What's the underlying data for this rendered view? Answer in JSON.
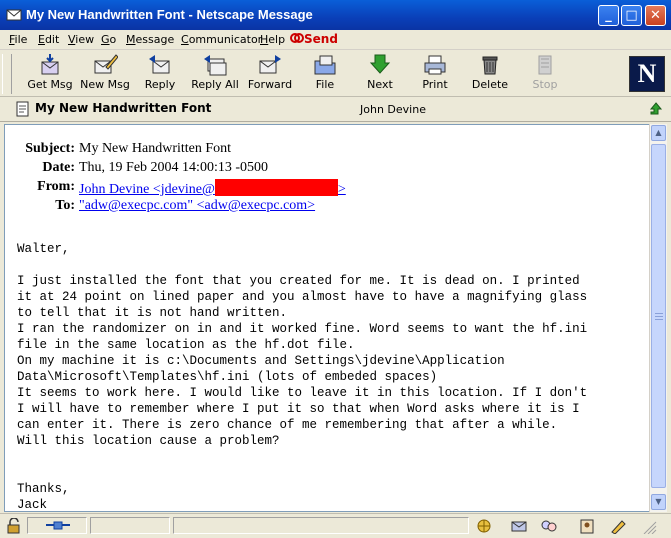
{
  "window": {
    "title": "My New Handwritten Font - Netscape Message"
  },
  "menu": {
    "items": [
      {
        "label": "File",
        "key": "F",
        "rest": "ile"
      },
      {
        "label": "Edit",
        "key": "E",
        "rest": "dit"
      },
      {
        "label": "View",
        "key": "V",
        "rest": "iew"
      },
      {
        "label": "Go",
        "key": "G",
        "rest": "o"
      },
      {
        "label": "Message",
        "key": "M",
        "rest": "essage"
      },
      {
        "label": "Communicator",
        "key": "C",
        "rest": "ommunicator"
      },
      {
        "label": "Help",
        "key": "H",
        "rest": "elp"
      }
    ],
    "send_label": "Send"
  },
  "toolbar": {
    "get_msg": "Get Msg",
    "new_msg": "New Msg",
    "reply": "Reply",
    "reply_all": "Reply All",
    "forward": "Forward",
    "file": "File",
    "next": "Next",
    "print": "Print",
    "delete": "Delete",
    "stop": "Stop",
    "logo_letter": "N"
  },
  "subject_bar": {
    "title": "My New Handwritten Font",
    "author": "John Devine"
  },
  "headers": {
    "subject_label": "Subject:",
    "subject_value": "My New Handwritten Font",
    "date_label": "Date:",
    "date_value": "Thu, 19 Feb 2004 14:00:13 -0500",
    "from_label": "From:",
    "from_value_start": "John Devine <jdevine@",
    "from_value_end": ">",
    "to_label": "To:",
    "to_value": "\"adw@execpc.com\" <adw@execpc.com>"
  },
  "body": {
    "text": "Walter,\n\nI just installed the font that you created for me. It is dead on. I printed\nit at 24 point on lined paper and you almost have to have a magnifying glass\nto tell that it is not hand written.\nI ran the randomizer on in and it worked fine. Word seems to want the hf.ini\nfile in the same location as the hf.dot file.\nOn my machine it is c:\\Documents and Settings\\jdevine\\Application\nData\\Microsoft\\Templates\\hf.ini (lots of embeded spaces)\nIt seems to work here. I would like to leave it in this location. If I don't\nI will have to remember where I put it so that when Word asks where it is I\ncan enter it. There is zero chance of me remembering that after a while.\nWill this location cause a problem?\n\n\nThanks,\nJack"
  },
  "colors": {
    "titlebar": "#0a5fd8",
    "redaction": "#ff0000",
    "link": "#0000ee"
  }
}
